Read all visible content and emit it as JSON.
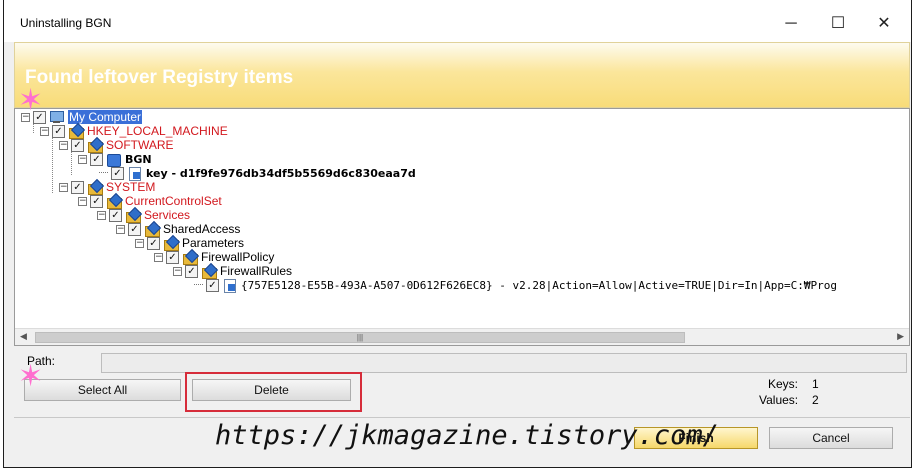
{
  "window": {
    "title": "Uninstalling BGN",
    "minimize_glyph": "─",
    "maximize_glyph": "☐",
    "close_glyph": "✕"
  },
  "banner": {
    "heading": "Found leftover Registry items"
  },
  "tree": [
    {
      "label": "My Computer",
      "icon": "computer-icon",
      "checked": true,
      "color": "selected"
    },
    {
      "label": "HKEY_LOCAL_MACHINE",
      "icon": "registry-folder-icon",
      "checked": true,
      "color": "#d2181e"
    },
    {
      "label": "SOFTWARE",
      "icon": "registry-folder-icon",
      "checked": true,
      "color": "#d2181e"
    },
    {
      "label": "BGN",
      "icon": "app-icon",
      "checked": true,
      "color": "bold"
    },
    {
      "label": "key - d1f9fe976db34df5b5569d6c830eaa7d",
      "icon": "registry-key-icon",
      "checked": true,
      "color": "bold"
    },
    {
      "label": "SYSTEM",
      "icon": "registry-folder-icon",
      "checked": true,
      "color": "#d2181e"
    },
    {
      "label": "CurrentControlSet",
      "icon": "registry-folder-icon",
      "checked": true,
      "color": "#d2181e"
    },
    {
      "label": "Services",
      "icon": "registry-folder-icon",
      "checked": true,
      "color": "#d2181e"
    },
    {
      "label": "SharedAccess",
      "icon": "registry-folder-icon",
      "checked": true,
      "color": "normal"
    },
    {
      "label": "Parameters",
      "icon": "registry-folder-icon",
      "checked": true,
      "color": "normal"
    },
    {
      "label": "FirewallPolicy",
      "icon": "registry-folder-icon",
      "checked": true,
      "color": "normal"
    },
    {
      "label": "FirewallRules",
      "icon": "registry-folder-icon",
      "checked": true,
      "color": "normal"
    },
    {
      "label": "{757E5128-E55B-493A-A507-0D612F626EC8} - v2.28|Action=Allow|Active=TRUE|Dir=In|App=C:₩Prog",
      "icon": "registry-key-icon",
      "checked": true,
      "color": "mono"
    }
  ],
  "path": {
    "label": "Path:",
    "value": ""
  },
  "buttons": {
    "select_all": "Select All",
    "delete": "Delete",
    "finish": "Finish",
    "cancel": "Cancel"
  },
  "stats": {
    "keys_label": "Keys:",
    "keys_value": "1",
    "values_label": "Values:",
    "values_value": "2"
  },
  "watermark": "https://jkmagazine.tistory.com/",
  "colors": {
    "banner": "#f8dc79",
    "highlight_box": "#d62c3a",
    "registry_red": "#d2181e",
    "selection": "#3a6fd8"
  }
}
